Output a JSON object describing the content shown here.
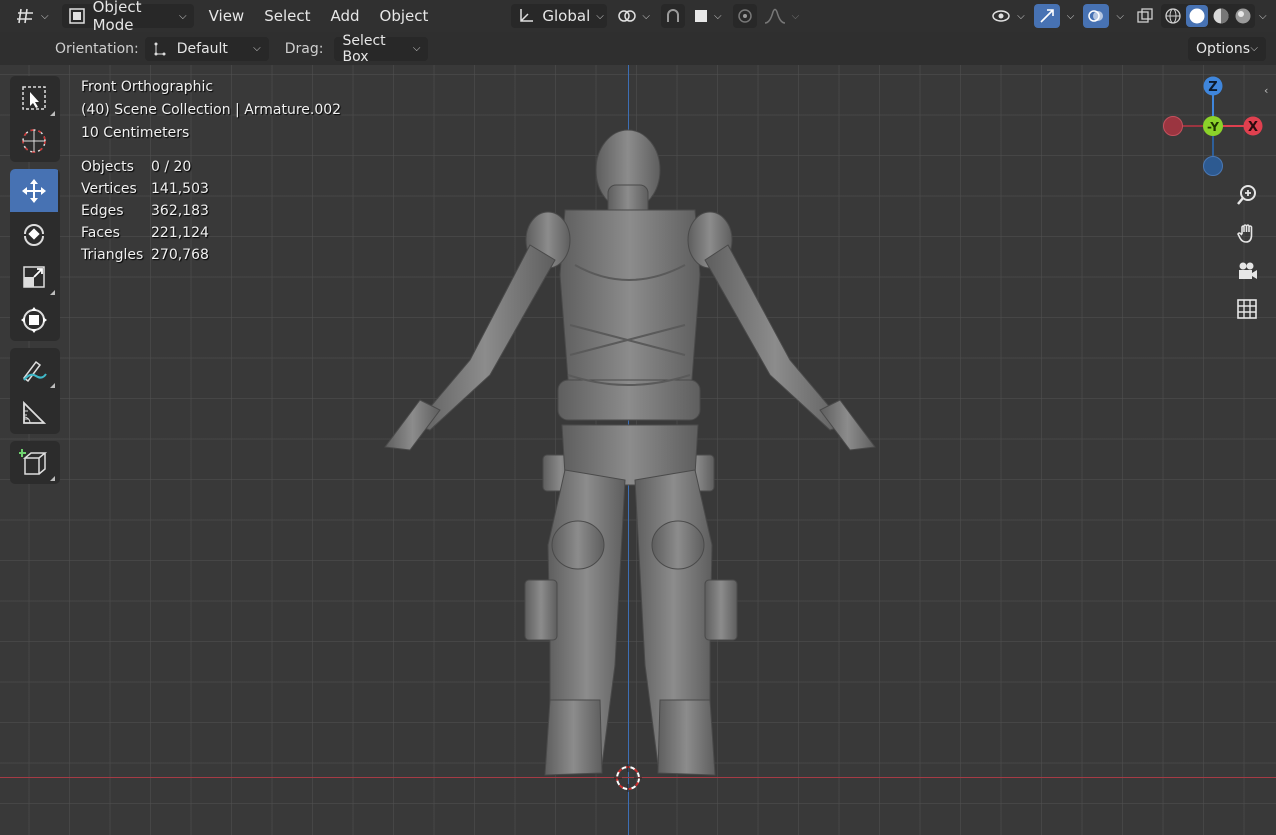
{
  "header": {
    "editor_type_icon": "axis-grid-icon",
    "mode": "Object Mode",
    "menus": [
      "View",
      "Select",
      "Add",
      "Object"
    ],
    "transform_orientation": "Global",
    "icons": [
      "transform-pivot-icon",
      "link-icon",
      "snap-icon",
      "snap-target-icon",
      "proportional-edit-icon",
      "falloff-icon",
      "visibility-icon",
      "gizmo-icon",
      "overlay-icon",
      "xray-icon",
      "wireframe-icon",
      "solid-icon",
      "material-icon",
      "rendered-icon"
    ]
  },
  "tool_settings": {
    "orientation_label": "Orientation:",
    "orientation_value": "Default",
    "drag_label": "Drag:",
    "drag_value": "Select Box",
    "options_label": "Options"
  },
  "toolbar": {
    "tools": [
      "select-box-icon",
      "cursor-icon",
      "move-icon",
      "rotate-icon",
      "scale-icon",
      "transform-icon",
      "annotate-icon",
      "measure-icon",
      "add-cube-icon"
    ],
    "active_tool": "move-icon"
  },
  "overlay": {
    "view_name": "Front Orthographic",
    "collection": "(40) Scene Collection | Armature.002",
    "scale": "10 Centimeters",
    "stats": [
      {
        "label": "Objects",
        "value": "0 / 20"
      },
      {
        "label": "Vertices",
        "value": "141,503"
      },
      {
        "label": "Edges",
        "value": "362,183"
      },
      {
        "label": "Faces",
        "value": "221,124"
      },
      {
        "label": "Triangles",
        "value": "270,768"
      }
    ]
  },
  "gizmo": {
    "z_label": "Z",
    "y_label": "-Y",
    "x_label": "X",
    "colors": {
      "x": "#e0404f",
      "y": "#8bd22a",
      "z": "#3f86dc"
    }
  },
  "nav_buttons": [
    "zoom-icon",
    "pan-hand-icon",
    "camera-icon",
    "ortho-grid-icon"
  ],
  "colors": {
    "accent": "#4772b3",
    "axis_x": "#a53b45",
    "axis_z": "#3d6fb5"
  }
}
